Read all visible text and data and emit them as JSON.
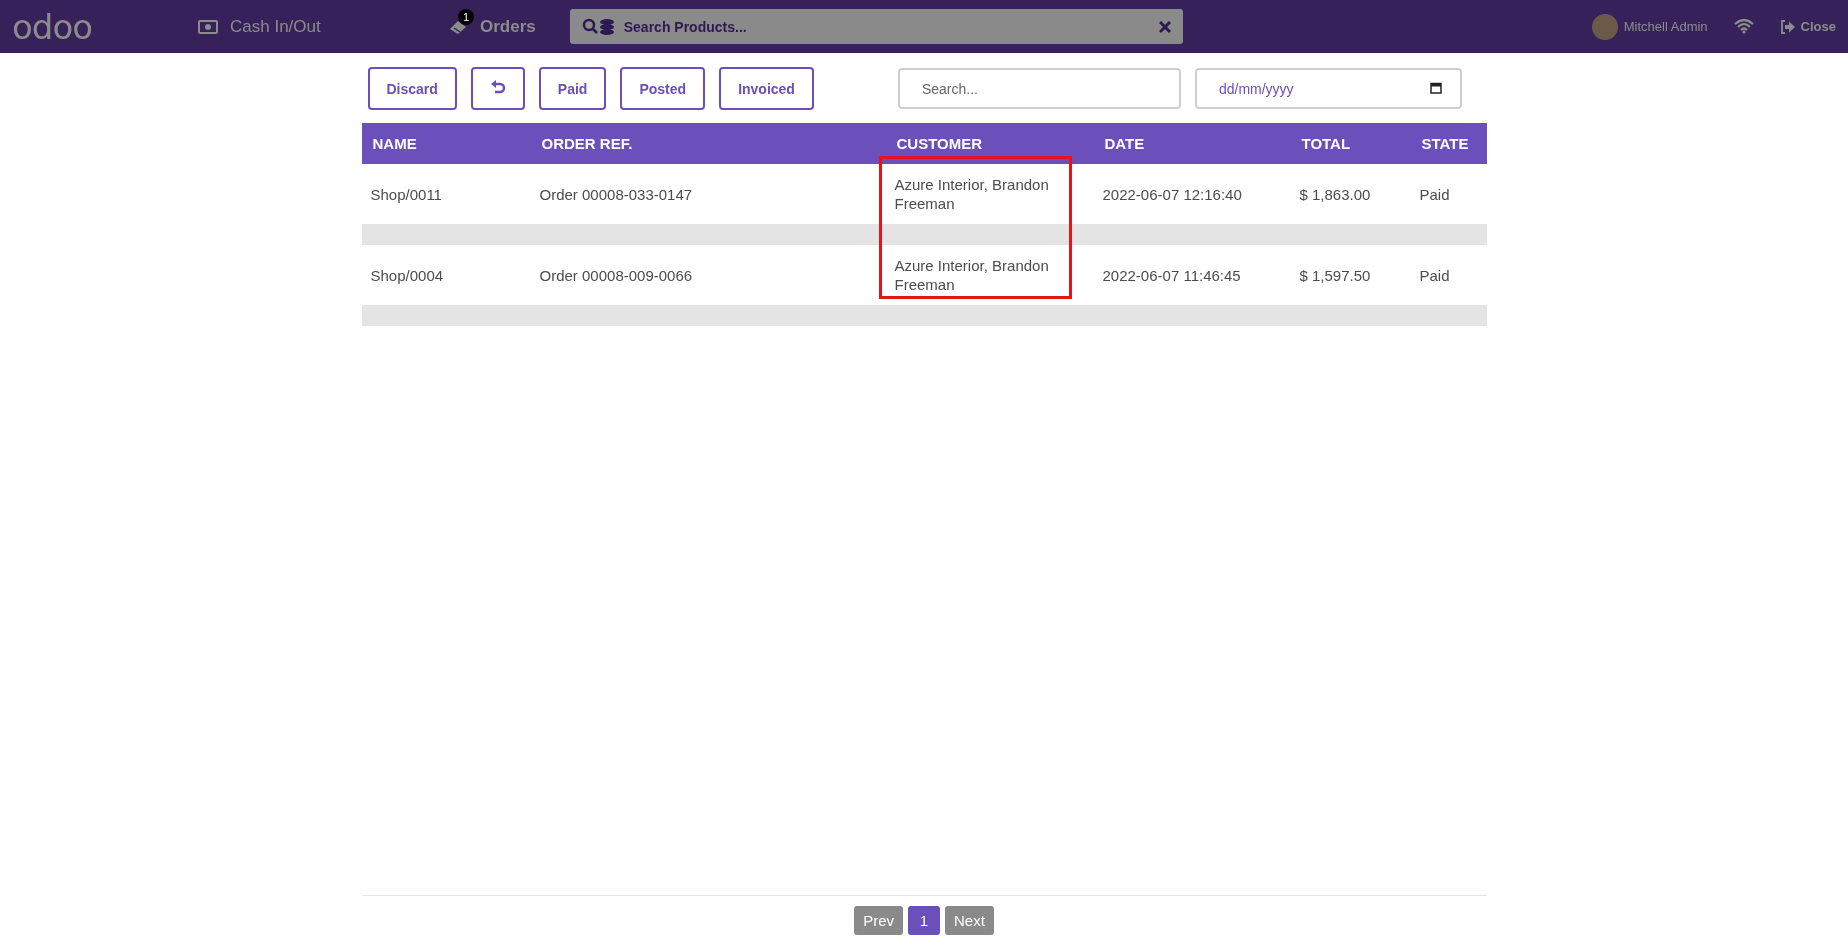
{
  "navbar": {
    "logo": "odoo",
    "cash_button": "Cash In/Out",
    "orders_button": {
      "label": "Orders",
      "badge": "1"
    },
    "search": {
      "placeholder": "Search Products..."
    },
    "user": "Mitchell Admin",
    "close": "Close"
  },
  "filter_buttons": [
    {
      "kind": "text",
      "label": "Discard"
    },
    {
      "kind": "undo"
    },
    {
      "kind": "text",
      "label": "Paid"
    },
    {
      "kind": "text",
      "label": "Posted"
    },
    {
      "kind": "text",
      "label": "Invoiced"
    }
  ],
  "search": {
    "placeholder": "Search..."
  },
  "date_field": {
    "placeholder": "dd/mm/yyyy"
  },
  "table": {
    "columns": [
      "NAME",
      "ORDER REF.",
      "CUSTOMER",
      "DATE",
      "TOTAL",
      "STATE"
    ],
    "rows": [
      [
        "Shop/0011",
        "Order 00008-033-0147",
        "Azure Interior, Brandon Freeman",
        "2022-06-07 12:16:40",
        "$ 1,863.00",
        "Paid"
      ],
      [
        "Shop/0004",
        "Order 00008-009-0066",
        "Azure Interior, Brandon Freeman",
        "2022-06-07 11:46:45",
        "$ 1,597.50",
        "Paid"
      ]
    ],
    "highlight": {
      "color": "#e8121b"
    }
  },
  "pagination": {
    "prev": "Prev",
    "pages": [
      {
        "label": "1",
        "selected": true
      }
    ],
    "next": "Next"
  }
}
